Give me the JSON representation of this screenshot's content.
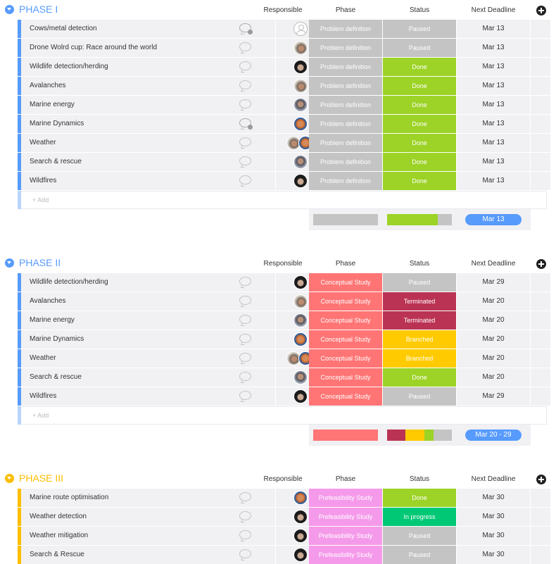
{
  "columns": {
    "responsible": "Responsible",
    "phase": "Phase",
    "status": "Status",
    "deadline": "Next Deadline"
  },
  "add_placeholder": "+ Add",
  "colors": {
    "phase1": "#579bfc",
    "phase2": "#579bfc",
    "phase3": "#fdbe00",
    "problem_definition": "#c4c4c4",
    "conceptual_study": "#ff7575",
    "prefeasibility_study": "#f59aea",
    "paused": "#c4c4c4",
    "done": "#9cd326",
    "terminated": "#bb3354",
    "branched": "#ffcb00",
    "in_progress": "#00c875",
    "date_pill": "#579bfc"
  },
  "groups": [
    {
      "title": "PHASE I",
      "rows": [
        {
          "name": "Cows/metal detection",
          "phase": "Problem definition",
          "status": "Paused",
          "deadline": "Mar 13"
        },
        {
          "name": "Drone Wolrd cup: Race around the world",
          "phase": "Problem definition",
          "status": "Paused",
          "deadline": "Mar 13"
        },
        {
          "name": "Wildlife detection/herding",
          "phase": "Problem definition",
          "status": "Done",
          "deadline": "Mar 13"
        },
        {
          "name": "Avalanches",
          "phase": "Problem definition",
          "status": "Done",
          "deadline": "Mar 13"
        },
        {
          "name": "Marine energy",
          "phase": "Problem definition",
          "status": "Done",
          "deadline": "Mar 13"
        },
        {
          "name": "Marine Dynamics",
          "phase": "Problem definition",
          "status": "Done",
          "deadline": "Mar 13"
        },
        {
          "name": "Weather",
          "phase": "Problem definition",
          "status": "Done",
          "deadline": "Mar 13"
        },
        {
          "name": "Search & rescue",
          "phase": "Problem definition",
          "status": "Done",
          "deadline": "Mar 13"
        },
        {
          "name": "Wildfires",
          "phase": "Problem definition",
          "status": "Done",
          "deadline": "Mar 13"
        }
      ],
      "summary_date": "Mar 13",
      "summary_status_share": {
        "done": 0.78,
        "paused": 0.22
      }
    },
    {
      "title": "PHASE II",
      "rows": [
        {
          "name": "Wildlife detection/herding",
          "phase": "Conceptual Study",
          "status": "Paused",
          "deadline": "Mar 29"
        },
        {
          "name": "Avalanches",
          "phase": "Conceptual Study",
          "status": "Terminated",
          "deadline": "Mar 20"
        },
        {
          "name": "Marine energy",
          "phase": "Conceptual Study",
          "status": "Terminated",
          "deadline": "Mar 20"
        },
        {
          "name": "Marine Dynamics",
          "phase": "Conceptual Study",
          "status": "Branched",
          "deadline": "Mar 20"
        },
        {
          "name": "Weather",
          "phase": "Conceptual Study",
          "status": "Branched",
          "deadline": "Mar 20"
        },
        {
          "name": "Search & rescue",
          "phase": "Conceptual Study",
          "status": "Done",
          "deadline": "Mar 20"
        },
        {
          "name": "Wildfires",
          "phase": "Conceptual Study",
          "status": "Paused",
          "deadline": "Mar 29"
        }
      ],
      "summary_date": "Mar 20 - 29",
      "summary_status_share": {
        "terminated": 0.286,
        "branched": 0.286,
        "done": 0.143,
        "paused": 0.285
      }
    },
    {
      "title": "PHASE III",
      "rows": [
        {
          "name": "Marine route optimisation",
          "phase": "Prefeasibility Study",
          "status": "Done",
          "deadline": "Mar 30"
        },
        {
          "name": "Weather detection",
          "phase": "Prefeasibility Study",
          "status": "In progress",
          "deadline": "Mar 30"
        },
        {
          "name": "Weather mitigation",
          "phase": "Prefeasibility Study",
          "status": "Paused",
          "deadline": "Mar 30"
        },
        {
          "name": "Search & Rescue",
          "phase": "Prefeasibility Study",
          "status": "Paused",
          "deadline": "Mar 30"
        }
      ]
    }
  ]
}
